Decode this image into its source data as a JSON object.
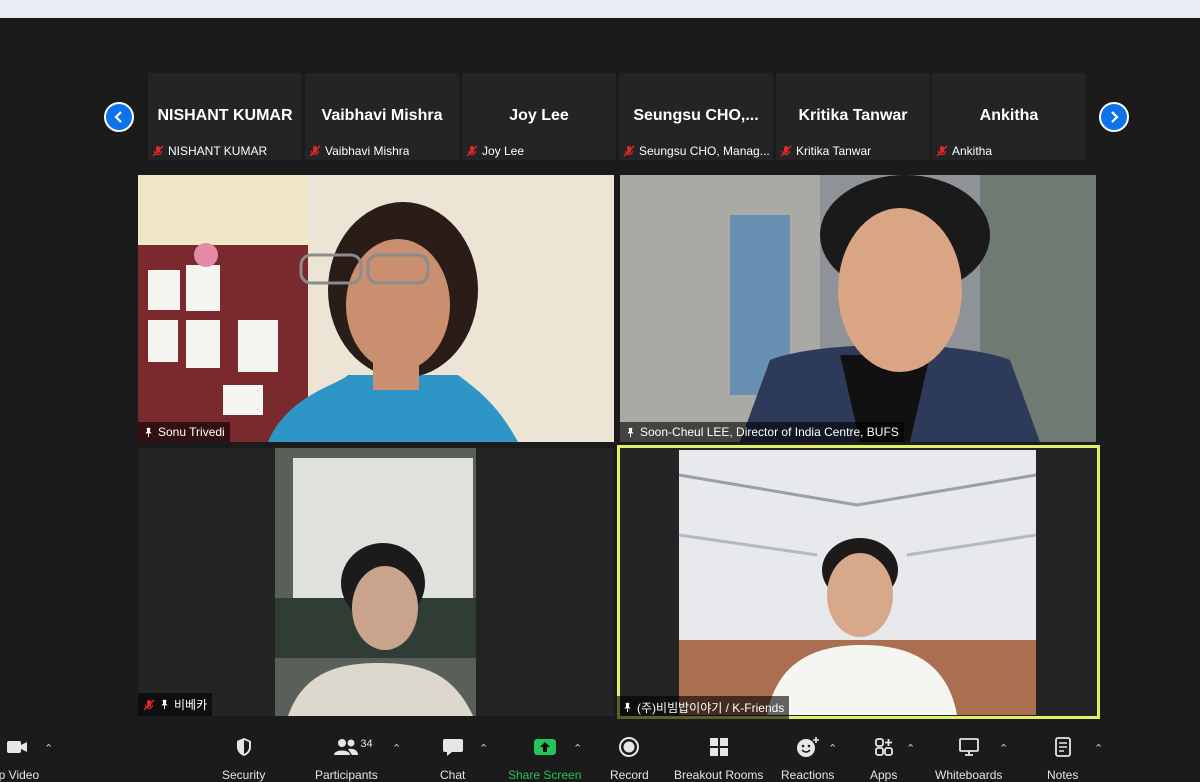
{
  "strip": {
    "tiles": [
      {
        "display": "NISHANT KUMAR",
        "name": "NISHANT KUMAR"
      },
      {
        "display": "Vaibhavi Mishra",
        "name": "Vaibhavi Mishra"
      },
      {
        "display": "Joy Lee",
        "name": "Joy Lee"
      },
      {
        "display": "Seungsu  CHO,...",
        "name": "Seungsu CHO, Manag..."
      },
      {
        "display": "Kritika Tanwar",
        "name": "Kritika Tanwar"
      },
      {
        "display": "Ankitha",
        "name": "Ankitha"
      }
    ]
  },
  "grid": {
    "tiles": [
      {
        "name": "Sonu Trivedi"
      },
      {
        "name": "Soon-Cheul LEE, Director of India Centre, BUFS"
      },
      {
        "name": "비베카"
      },
      {
        "name": "(주)비빔밥이야기 / K-Friends"
      }
    ]
  },
  "toolbar": {
    "video": "op Video",
    "security": "Security",
    "participants": "Participants",
    "participants_count": "34",
    "chat": "Chat",
    "share": "Share Screen",
    "record": "Record",
    "breakout": "Breakout Rooms",
    "reactions": "Reactions",
    "apps": "Apps",
    "whiteboards": "Whiteboards",
    "notes": "Notes"
  },
  "colors": {
    "accent_blue": "#0e72ed",
    "active_speaker": "#dff06a",
    "share_green": "#25c35a",
    "mute_red": "#e02828"
  }
}
